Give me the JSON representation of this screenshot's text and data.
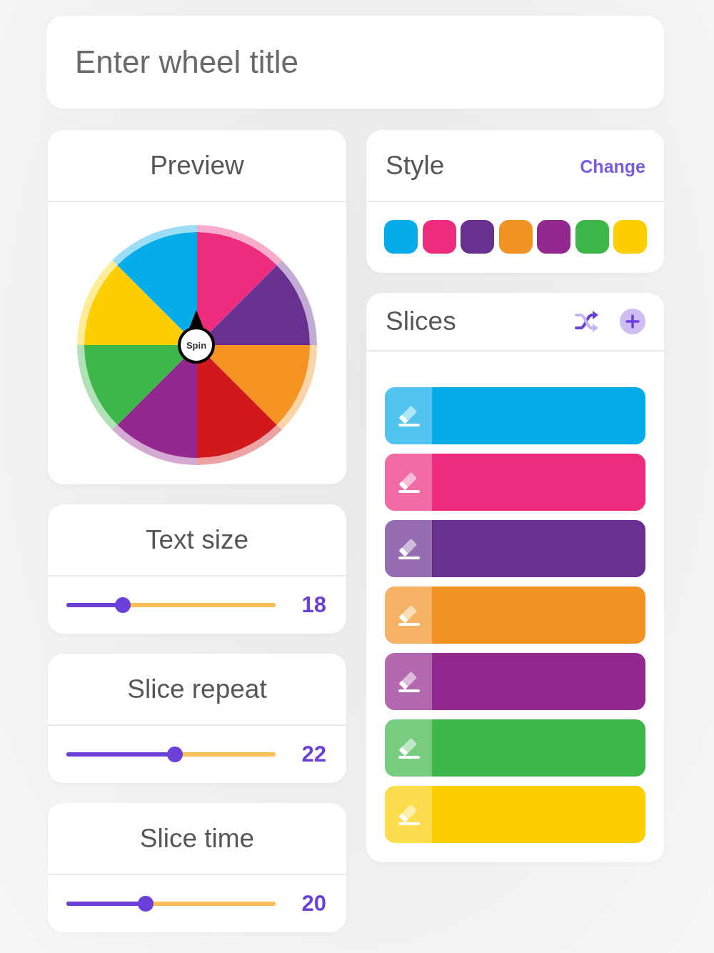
{
  "title_field": {
    "placeholder": "Enter wheel title"
  },
  "preview": {
    "title": "Preview",
    "wheel": {
      "center_label": "Spin",
      "slices": [
        {
          "color": "#ee2c7d"
        },
        {
          "color": "#692f91"
        },
        {
          "color": "#f59423"
        },
        {
          "color": "#d1191c"
        },
        {
          "color": "#93288e"
        },
        {
          "color": "#3db64a"
        },
        {
          "color": "#fdcf00"
        },
        {
          "color": "#06ace8"
        }
      ]
    }
  },
  "settings": [
    {
      "title": "Text size",
      "level": 0.27,
      "value": "18"
    },
    {
      "title": "Slice repeat",
      "level": 0.52,
      "value": "22"
    },
    {
      "title": "Slice time",
      "level": 0.38,
      "value": "20"
    }
  ],
  "style": {
    "title": "Style",
    "action": "Change",
    "swatches": [
      {
        "color": "#06ace8"
      },
      {
        "color": "#ee2c7d"
      },
      {
        "color": "#692f91"
      },
      {
        "color": "#f39224"
      },
      {
        "color": "#93288e"
      },
      {
        "color": "#3db64a"
      },
      {
        "color": "#fdcf00"
      }
    ]
  },
  "slices": {
    "title": "Slices",
    "items": [
      {
        "color": "#06ace8"
      },
      {
        "color": "#ee2c7d"
      },
      {
        "color": "#692f91"
      },
      {
        "color": "#f39224"
      },
      {
        "color": "#93288e"
      },
      {
        "color": "#3db64a"
      },
      {
        "color": "#fdcf00"
      }
    ]
  }
}
